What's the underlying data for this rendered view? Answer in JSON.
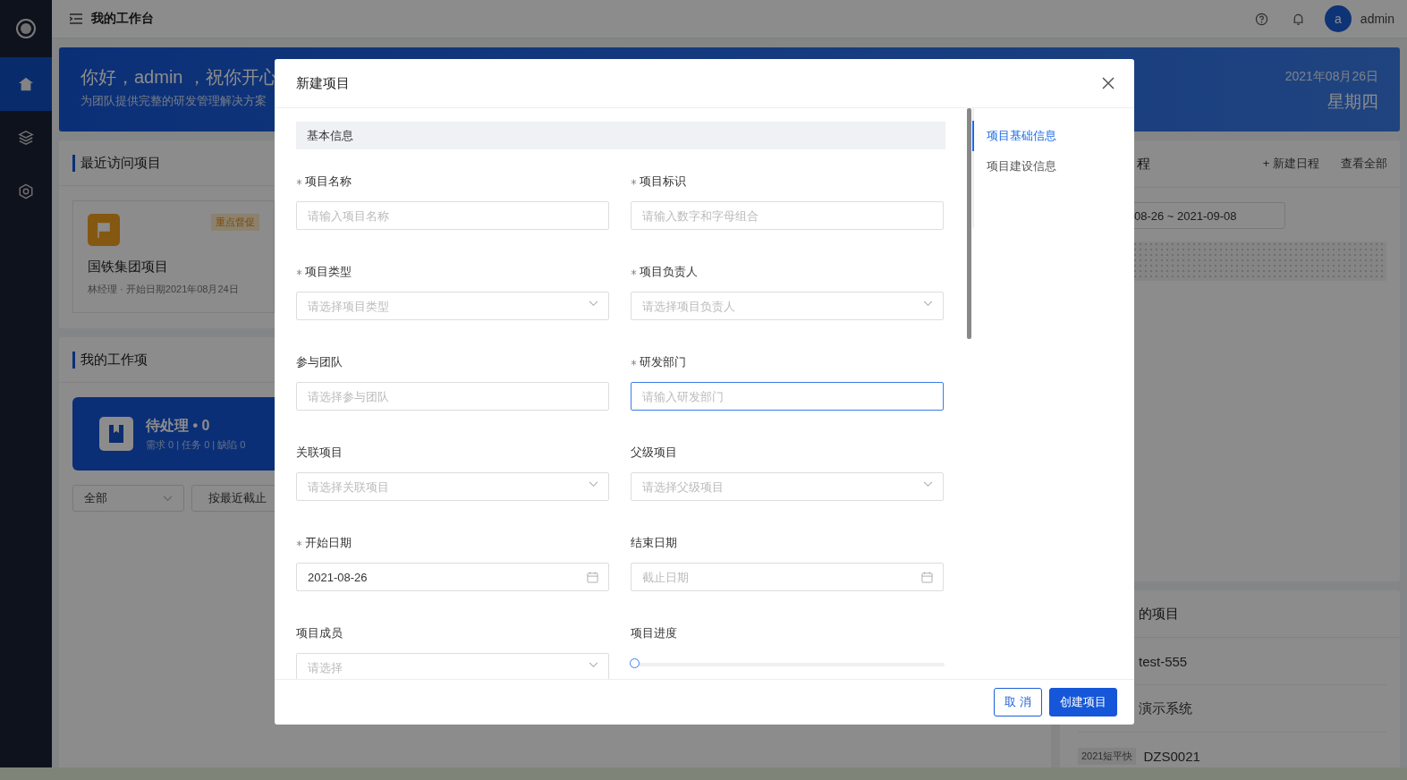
{
  "sidebar": {
    "items": [
      {
        "selected": true
      },
      {
        "selected": false
      },
      {
        "selected": false
      }
    ]
  },
  "header": {
    "title": "我的工作台",
    "avatar": "a",
    "user": "admin"
  },
  "banner": {
    "greeting": "你好，admin ，祝你开心",
    "subtitle": "为团队提供完整的研发管理解决方案",
    "date": "2021年08月26日",
    "weekday": "星期四"
  },
  "recent": {
    "title": "最近访问项目",
    "project": {
      "badge": "重点督促",
      "name": "国铁集团项目",
      "meta": "林经理 · 开始日期2021年08月24日"
    }
  },
  "work": {
    "title": "我的工作项",
    "pending": {
      "title": "待处理 • 0",
      "detail": "需求 0 | 任务 0 | 缺陷 0"
    },
    "filter": "全部",
    "sort": "按最近截止"
  },
  "schedule": {
    "title": "程",
    "actions": [
      "+ 新建日程",
      "查看全部"
    ],
    "range": "08-26 ~ 2021-09-08"
  },
  "projects": {
    "title": "的项目",
    "rows": [
      {
        "name": "test-555"
      },
      {
        "name": "演示系统"
      },
      {
        "tag": "2021短平快",
        "name": "DZS0021"
      }
    ]
  },
  "modal": {
    "title": "新建项目",
    "section": "基本信息",
    "fields": [
      {
        "label": "项目名称",
        "required": true,
        "kind": "input",
        "placeholder": "请输入项目名称",
        "focused": false
      },
      {
        "label": "项目标识",
        "required": true,
        "kind": "input",
        "placeholder": "请输入数字和字母组合",
        "focused": false
      },
      {
        "label": "项目类型",
        "required": true,
        "kind": "select",
        "placeholder": "请选择项目类型"
      },
      {
        "label": "项目负责人",
        "required": true,
        "kind": "select",
        "placeholder": "请选择项目负责人"
      },
      {
        "label": "参与团队",
        "required": false,
        "kind": "input",
        "placeholder": "请选择参与团队",
        "focused": false
      },
      {
        "label": "研发部门",
        "required": true,
        "kind": "input",
        "placeholder": "请输入研发部门",
        "focused": true
      },
      {
        "label": "关联项目",
        "required": false,
        "kind": "select",
        "placeholder": "请选择关联项目"
      },
      {
        "label": "父级项目",
        "required": false,
        "kind": "select",
        "placeholder": "请选择父级项目"
      },
      {
        "label": "开始日期",
        "required": true,
        "kind": "date",
        "value": "2021-08-26"
      },
      {
        "label": "结束日期",
        "required": false,
        "kind": "date",
        "placeholder": "截止日期"
      },
      {
        "label": "项目成员",
        "required": false,
        "kind": "select",
        "placeholder": "请选择"
      },
      {
        "label": "项目进度",
        "required": false,
        "kind": "slider",
        "level": 0
      }
    ],
    "nav": [
      {
        "label": "项目基础信息",
        "selected": true
      },
      {
        "label": "项目建设信息",
        "selected": false
      }
    ],
    "buttons": [
      {
        "label": "取 消",
        "kind": "cancel"
      },
      {
        "label": "创建项目",
        "kind": "primary"
      }
    ]
  }
}
